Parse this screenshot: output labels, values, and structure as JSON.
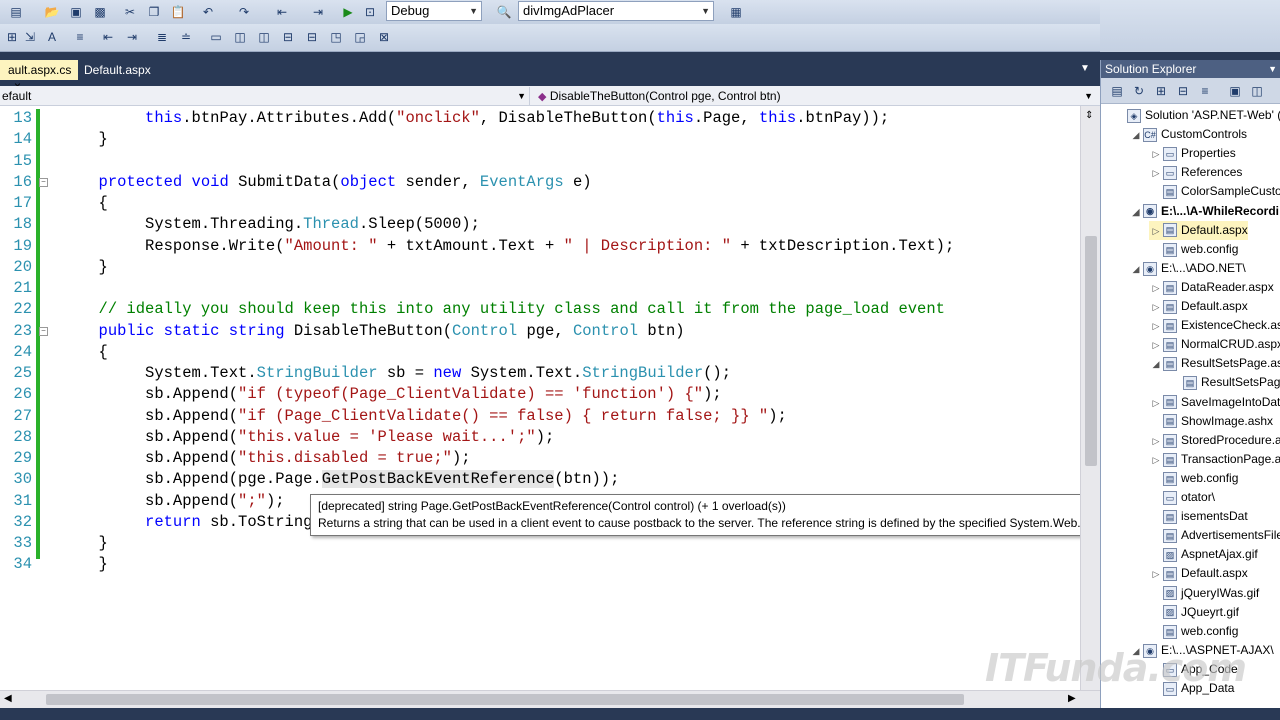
{
  "toolbar": {
    "config_value": "Debug",
    "target_value": "divImgAdPlacer"
  },
  "tabs": [
    {
      "label": "ault.aspx.cs",
      "close": "×"
    },
    {
      "label": "Default.aspx"
    }
  ],
  "navbar": {
    "type_dropdown": "efault",
    "member_dropdown": "DisableTheButton(Control pge, Control btn)"
  },
  "code_lines": [
    {
      "num": "13",
      "indent": "    ",
      "text": "this.btnPay.Attributes.Add(\"onclick\", DisableTheButton(this.Page, this.btnPay));"
    },
    {
      "num": "14",
      "indent": "",
      "text": "}"
    },
    {
      "num": "15",
      "indent": "",
      "text": ""
    },
    {
      "num": "16",
      "indent": "",
      "text": "protected void SubmitData(object sender, EventArgs e)"
    },
    {
      "num": "17",
      "indent": "",
      "text": "{"
    },
    {
      "num": "18",
      "indent": "    ",
      "text": "System.Threading.Thread.Sleep(5000);"
    },
    {
      "num": "19",
      "indent": "    ",
      "text": "Response.Write(\"Amount: \" + txtAmount.Text + \" | Description: \" + txtDescription.Text);"
    },
    {
      "num": "20",
      "indent": "",
      "text": "}"
    },
    {
      "num": "21",
      "indent": "",
      "text": ""
    },
    {
      "num": "22",
      "indent": "",
      "text": "// ideally you should keep this into any utility class and call it from the page_load event"
    },
    {
      "num": "23",
      "indent": "",
      "text": "public static string DisableTheButton(Control pge, Control btn)"
    },
    {
      "num": "24",
      "indent": "",
      "text": "{"
    },
    {
      "num": "25",
      "indent": "    ",
      "text": "System.Text.StringBuilder sb = new System.Text.StringBuilder();"
    },
    {
      "num": "26",
      "indent": "    ",
      "text": "sb.Append(\"if (typeof(Page_ClientValidate) == 'function') {\");"
    },
    {
      "num": "27",
      "indent": "    ",
      "text": "sb.Append(\"if (Page_ClientValidate() == false) { return false; }} \");"
    },
    {
      "num": "28",
      "indent": "    ",
      "text": "sb.Append(\"this.value = 'Please wait...';\");"
    },
    {
      "num": "29",
      "indent": "    ",
      "text": "sb.Append(\"this.disabled = true;\");"
    },
    {
      "num": "30",
      "indent": "    ",
      "text": "sb.Append(pge.Page.GetPostBackEventReference(btn));"
    },
    {
      "num": "31",
      "indent": "    ",
      "text": "sb.Append(\";\");"
    },
    {
      "num": "32",
      "indent": "    ",
      "text": "return sb.ToString("
    },
    {
      "num": "33",
      "indent": "",
      "text": "}"
    },
    {
      "num": "34",
      "indent": "",
      "text": "}"
    }
  ],
  "tooltip": {
    "line1": "[deprecated] string Page.GetPostBackEventReference(Control control)  (+ 1 overload(s))",
    "line2": "Returns a string that can be used in a client event to cause postback to the server. The reference string is defined by the specified System.Web.UI.Control object."
  },
  "solution_explorer": {
    "title": "Solution Explorer",
    "nodes": [
      {
        "label": "Solution 'ASP.NET-Web' (",
        "level": 0,
        "expander": "",
        "icon": "solution-icon"
      },
      {
        "label": "CustomControls",
        "level": 1,
        "expander": "◢",
        "icon": "project-icon"
      },
      {
        "label": "Properties",
        "level": 2,
        "expander": "▷",
        "icon": "folder-icon"
      },
      {
        "label": "References",
        "level": 2,
        "expander": "▷",
        "icon": "folder-icon"
      },
      {
        "label": "ColorSampleCusto",
        "level": 2,
        "expander": "",
        "icon": "file-icon"
      },
      {
        "label": "E:\\...\\A-WhileRecordi",
        "level": 1,
        "expander": "◢",
        "icon": "website-icon",
        "bold": true
      },
      {
        "label": "Default.aspx",
        "level": 2,
        "expander": "▷",
        "icon": "file-icon",
        "selected": true
      },
      {
        "label": "web.config",
        "level": 2,
        "expander": "",
        "icon": "file-icon"
      },
      {
        "label": "E:\\...\\ADO.NET\\",
        "level": 1,
        "expander": "◢",
        "icon": "website-icon"
      },
      {
        "label": "DataReader.aspx",
        "level": 2,
        "expander": "▷",
        "icon": "file-icon"
      },
      {
        "label": "Default.aspx",
        "level": 2,
        "expander": "▷",
        "icon": "file-icon"
      },
      {
        "label": "ExistenceCheck.asp",
        "level": 2,
        "expander": "▷",
        "icon": "file-icon"
      },
      {
        "label": "NormalCRUD.aspx",
        "level": 2,
        "expander": "▷",
        "icon": "file-icon"
      },
      {
        "label": "ResultSetsPage.asp",
        "level": 2,
        "expander": "◢",
        "icon": "file-icon"
      },
      {
        "label": "ResultSetsPage",
        "level": 3,
        "expander": "",
        "icon": "file-icon"
      },
      {
        "label": "SaveImageIntoDat",
        "level": 2,
        "expander": "▷",
        "icon": "file-icon"
      },
      {
        "label": "ShowImage.ashx",
        "level": 2,
        "expander": "",
        "icon": "file-icon"
      },
      {
        "label": "StoredProcedure.a",
        "level": 2,
        "expander": "▷",
        "icon": "file-icon"
      },
      {
        "label": "TransactionPage.a",
        "level": 2,
        "expander": "▷",
        "icon": "file-icon"
      },
      {
        "label": "web.config",
        "level": 2,
        "expander": "",
        "icon": "file-icon"
      },
      {
        "label": "otator\\",
        "level": 2,
        "expander": "",
        "icon": "folder-icon"
      },
      {
        "label": "isementsDat",
        "level": 2,
        "expander": "",
        "icon": "file-icon"
      },
      {
        "label": "AdvertisementsFile",
        "level": 2,
        "expander": "",
        "icon": "file-icon"
      },
      {
        "label": "AspnetAjax.gif",
        "level": 2,
        "expander": "",
        "icon": "image-icon"
      },
      {
        "label": "Default.aspx",
        "level": 2,
        "expander": "▷",
        "icon": "file-icon"
      },
      {
        "label": "jQueryIWas.gif",
        "level": 2,
        "expander": "",
        "icon": "image-icon"
      },
      {
        "label": "JQueyrt.gif",
        "level": 2,
        "expander": "",
        "icon": "image-icon"
      },
      {
        "label": "web.config",
        "level": 2,
        "expander": "",
        "icon": "file-icon"
      },
      {
        "label": "E:\\...\\ASPNET-AJAX\\",
        "level": 1,
        "expander": "◢",
        "icon": "website-icon"
      },
      {
        "label": "App_Code",
        "level": 2,
        "expander": "",
        "icon": "folder-icon"
      },
      {
        "label": "App_Data",
        "level": 2,
        "expander": "",
        "icon": "folder-icon"
      }
    ]
  },
  "watermark": "ITFunda.com"
}
